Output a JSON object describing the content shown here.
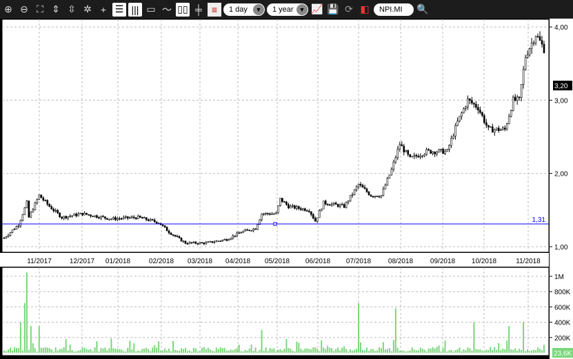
{
  "toolbar": {
    "icons": [
      "zoom-in-icon",
      "zoom-out-icon",
      "fit-icon",
      "vzoom-in-icon",
      "vzoom-out-icon",
      "reset-zoom-icon",
      "crosshair-icon",
      "list-icon",
      "bars-icon",
      "window-icon",
      "line-chart-icon",
      "candlestick-icon",
      "ohlc-icon",
      "legend-icon"
    ],
    "interval": "1 day",
    "range": "1 year",
    "symbol": "NPI.MI"
  },
  "chart_data": {
    "type": "line",
    "symbol": "NPI.MI",
    "x_ticks": [
      "11/2017",
      "12/2017",
      "01/2018",
      "02/2018",
      "03/2018",
      "04/2018",
      "05/2018",
      "06/2018",
      "07/2018",
      "08/2018",
      "09/2018",
      "10/2018",
      "11/2018"
    ],
    "price_axis": {
      "ticks": [
        "1,00",
        "2,00",
        "3,00",
        "4,00"
      ],
      "range": [
        0.96,
        4.18
      ]
    },
    "last_price_label": "3,20",
    "horizontal_line_label": "1,31",
    "horizontal_line_value": 1.31,
    "price_keypoints_day_close": [
      [
        0,
        1.12
      ],
      [
        7,
        1.3
      ],
      [
        11,
        1.6
      ],
      [
        12,
        1.4
      ],
      [
        17,
        1.7
      ],
      [
        22,
        1.55
      ],
      [
        28,
        1.4
      ],
      [
        38,
        1.45
      ],
      [
        52,
        1.38
      ],
      [
        65,
        1.4
      ],
      [
        75,
        1.33
      ],
      [
        80,
        1.2
      ],
      [
        88,
        1.05
      ],
      [
        98,
        1.05
      ],
      [
        108,
        1.1
      ],
      [
        115,
        1.2
      ],
      [
        122,
        1.25
      ],
      [
        125,
        1.45
      ],
      [
        132,
        1.45
      ],
      [
        134,
        1.65
      ],
      [
        138,
        1.55
      ],
      [
        148,
        1.5
      ],
      [
        151,
        1.35
      ],
      [
        155,
        1.6
      ],
      [
        165,
        1.55
      ],
      [
        172,
        1.85
      ],
      [
        178,
        1.7
      ],
      [
        183,
        1.7
      ],
      [
        188,
        2.05
      ],
      [
        192,
        2.4
      ],
      [
        197,
        2.2
      ],
      [
        205,
        2.3
      ],
      [
        215,
        2.3
      ],
      [
        220,
        2.7
      ],
      [
        225,
        3.0
      ],
      [
        230,
        2.9
      ],
      [
        235,
        2.6
      ],
      [
        243,
        2.6
      ],
      [
        247,
        3.0
      ],
      [
        250,
        3.0
      ],
      [
        253,
        3.6
      ],
      [
        258,
        3.9
      ],
      [
        262,
        3.7
      ]
    ],
    "volume_axis": {
      "ticks": [
        "200K",
        "400K",
        "600K",
        "800K",
        "1M"
      ],
      "max": 1100000
    },
    "volume_last_label": "23,6K",
    "volume_spikes_day_value": [
      [
        8,
        400000
      ],
      [
        10,
        650000
      ],
      [
        11,
        1050000
      ],
      [
        13,
        350000
      ],
      [
        17,
        350000
      ],
      [
        125,
        300000
      ],
      [
        172,
        650000
      ],
      [
        190,
        580000
      ],
      [
        228,
        400000
      ],
      [
        245,
        350000
      ],
      [
        252,
        400000
      ]
    ]
  }
}
